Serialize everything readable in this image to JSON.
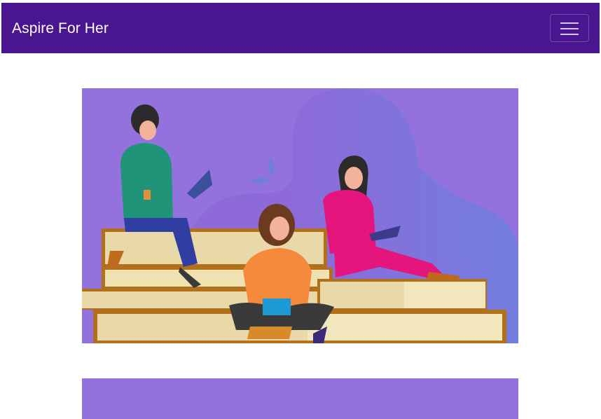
{
  "navbar": {
    "brand": "Aspire For Her",
    "toggler_icon": "hamburger-menu-icon",
    "background": "#4a168f"
  },
  "hero": {
    "illustration": "women-reading-on-books-illustration",
    "background": "#9372dd"
  },
  "second_card": {
    "background": "#9372dd"
  }
}
